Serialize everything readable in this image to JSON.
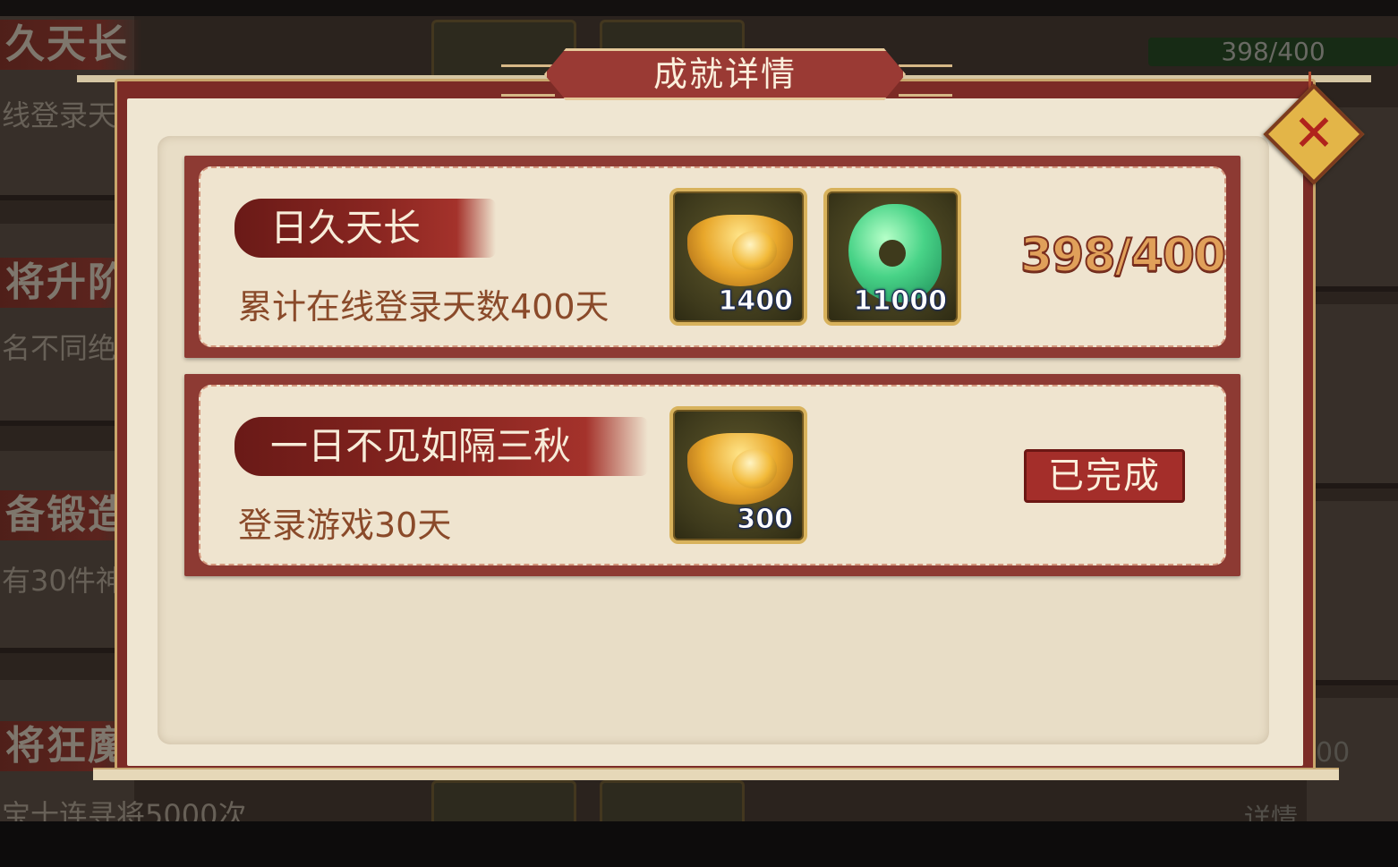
{
  "background": {
    "rows": [
      {
        "title": "久天长",
        "desc": "线登录天"
      },
      {
        "title": "将升阶",
        "desc": "名不同绝"
      },
      {
        "title": "备锻造",
        "desc": "有30件神"
      },
      {
        "title": "将狂魔",
        "desc": "宝十连寻将5000次"
      }
    ],
    "progress": "398/400",
    "right_frag_1": "00",
    "right_frag_2": "详情"
  },
  "modal": {
    "title": "成就详情",
    "close_icon": "close-x-icon"
  },
  "achievements": [
    {
      "title": "日久天长",
      "desc": "累计在线登录天数400天",
      "rewards": [
        {
          "icon": "gold-ingot-icon",
          "count": "1400"
        },
        {
          "icon": "jade-icon",
          "count": "11000"
        }
      ],
      "progress": "398/400"
    },
    {
      "title": "一日不见如隔三秋",
      "desc": "登录游戏30天",
      "rewards": [
        {
          "icon": "gold-ingot-icon",
          "count": "300"
        }
      ],
      "status": "已完成"
    }
  ],
  "colors": {
    "frame_red": "#7c2b26",
    "parchment": "#efe6d2",
    "gold": "#d8b25c",
    "progress_text": "#e0a05a"
  }
}
